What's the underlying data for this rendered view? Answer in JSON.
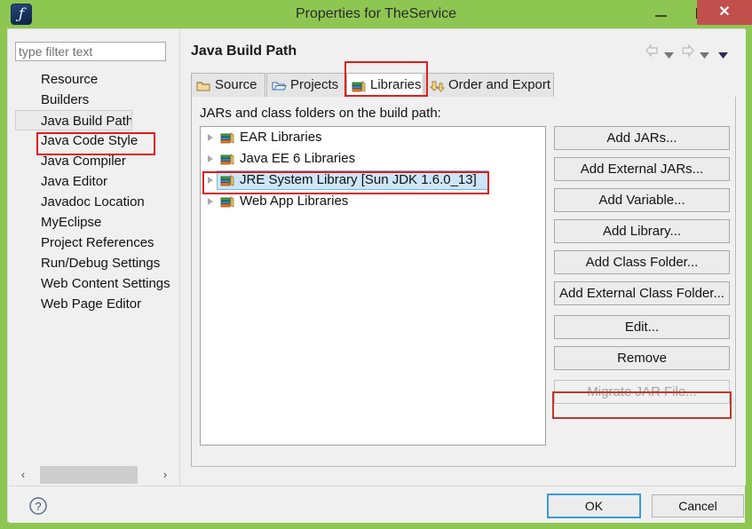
{
  "titlebar": {
    "title": "Properties for TheService",
    "app_icon": "myeclipse-logo-icon",
    "app_glyph": "ƒ",
    "minimize_label": "",
    "maximize_label": "",
    "close_label": "✕",
    "bg_color": "#8ec652",
    "close_bg_color": "#c1504d"
  },
  "sidebar": {
    "filter": {
      "placeholder": "type filter text",
      "value": ""
    },
    "items": [
      {
        "label": "Resource",
        "selected": false
      },
      {
        "label": "Builders",
        "selected": false
      },
      {
        "label": "Java Build Path",
        "selected": true
      },
      {
        "label": "Java Code Style",
        "selected": false
      },
      {
        "label": "Java Compiler",
        "selected": false
      },
      {
        "label": "Java Editor",
        "selected": false
      },
      {
        "label": "Javadoc Location",
        "selected": false
      },
      {
        "label": "MyEclipse",
        "selected": false
      },
      {
        "label": "Project References",
        "selected": false
      },
      {
        "label": "Run/Debug Settings",
        "selected": false
      },
      {
        "label": "Web Content Settings",
        "selected": false
      },
      {
        "label": "Web Page Editor",
        "selected": false
      }
    ],
    "scrollbar": {
      "left_arrow": "‹",
      "right_arrow": "›"
    }
  },
  "content": {
    "page_title": "Java Build Path",
    "nav": {
      "back_icon": "arrow-left-icon",
      "back_menu_icon": "chevron-down-icon",
      "forward_icon": "arrow-right-icon",
      "forward_menu_icon": "chevron-down-icon",
      "view_menu_icon": "chevron-down-icon"
    },
    "tabs": [
      {
        "label": "Source",
        "icon": "package-folder-icon",
        "active": false
      },
      {
        "label": "Projects",
        "icon": "open-folder-icon",
        "active": false
      },
      {
        "label": "Libraries",
        "icon": "library-books-icon",
        "active": true
      },
      {
        "label": "Order and Export",
        "icon": "order-arrows-icon",
        "active": false
      }
    ],
    "jars_label": "JARs and class folders on the build path:",
    "tree_items": [
      {
        "label": "EAR Libraries",
        "icon": "library-books-icon",
        "expandable": true,
        "selected": false
      },
      {
        "label": "Java EE 6 Libraries",
        "icon": "library-books-icon",
        "expandable": true,
        "selected": false
      },
      {
        "label": "JRE System Library [Sun JDK 1.6.0_13]",
        "icon": "library-books-icon",
        "expandable": true,
        "selected": true
      },
      {
        "label": "Web App Libraries",
        "icon": "library-books-icon",
        "expandable": true,
        "selected": false
      }
    ],
    "buttons": [
      {
        "label": "Add JARs...",
        "disabled": false
      },
      {
        "label": "Add External JARs...",
        "disabled": false
      },
      {
        "label": "Add Variable...",
        "disabled": false
      },
      {
        "label": "Add Library...",
        "disabled": false
      },
      {
        "label": "Add Class Folder...",
        "disabled": false
      },
      {
        "label": "Add External Class Folder...",
        "disabled": false
      },
      {
        "label": "Edit...",
        "disabled": false
      },
      {
        "label": "Remove",
        "disabled": false
      },
      {
        "label": "Migrate JAR File...",
        "disabled": true
      }
    ]
  },
  "footer": {
    "help_icon": "help-question-icon",
    "ok_label": "OK",
    "cancel_label": "Cancel"
  },
  "annotations": {
    "highlight_color": "#e01b1b",
    "targets": [
      "Java Build Path",
      "Libraries",
      "JRE System Library [Sun JDK 1.6.0_13]",
      "Edit..."
    ]
  }
}
